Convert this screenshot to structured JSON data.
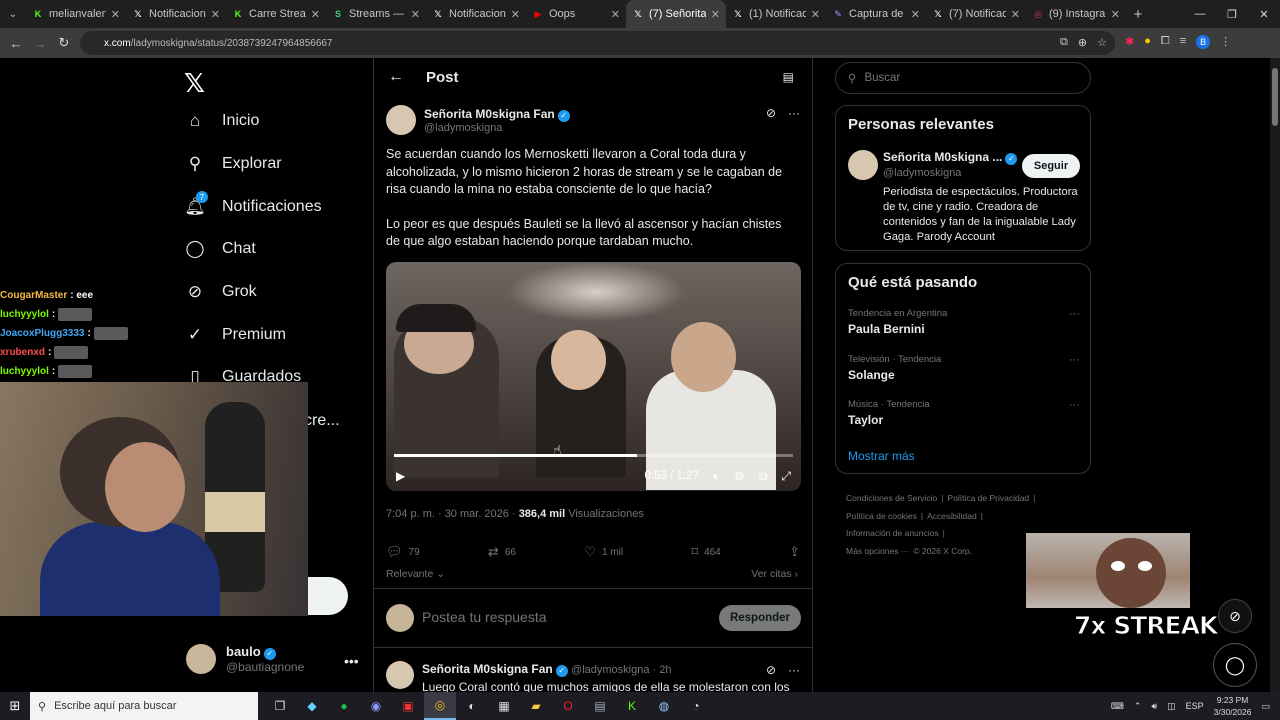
{
  "browser": {
    "tabs": [
      {
        "title": "melianvalen - ",
        "favicon": "kick-icon",
        "color": "#53fc18"
      },
      {
        "title": "Notificaciones",
        "favicon": "x-icon",
        "color": "#ffffff"
      },
      {
        "title": "Carre Stream - ",
        "favicon": "kick-icon",
        "color": "#53fc18"
      },
      {
        "title": "Streams — MC",
        "favicon": "streams-icon",
        "color": "#3fc97a"
      },
      {
        "title": "Notificaciones",
        "favicon": "x-icon",
        "color": "#ffffff"
      },
      {
        "title": "Oops",
        "favicon": "youtube-icon",
        "color": "#ff0000"
      },
      {
        "title": "(7) Señorita M(",
        "favicon": "x-icon",
        "color": "#ffffff"
      },
      {
        "title": "(1) Notificacion",
        "favicon": "x-icon",
        "color": "#ffffff"
      },
      {
        "title": "Captura de pa",
        "favicon": "snip-icon",
        "color": "#b48cff"
      },
      {
        "title": "(7) Notificacio",
        "favicon": "x-icon",
        "color": "#ffffff"
      },
      {
        "title": "(9) Instagram",
        "favicon": "instagram-icon",
        "color": "#e1306c"
      }
    ],
    "active_tab": 6,
    "url_host": "x.com",
    "url_path": "/ladymoskigna/status/2038739247964856667"
  },
  "nav": {
    "items": [
      {
        "label": "Inicio",
        "icon": "home-icon",
        "glyph": "⌂"
      },
      {
        "label": "Explorar",
        "icon": "search-icon",
        "glyph": "⚲"
      },
      {
        "label": "Notificaciones",
        "icon": "bell-icon",
        "glyph": "🔔︎",
        "badge": "7"
      },
      {
        "label": "Chat",
        "icon": "chat-icon",
        "glyph": "◯"
      },
      {
        "label": "Grok",
        "icon": "grok-icon",
        "glyph": "⊘"
      },
      {
        "label": "Premium",
        "icon": "premium-icon",
        "glyph": "✓"
      },
      {
        "label": "Guardados",
        "icon": "bookmark-icon",
        "glyph": "▯"
      }
    ],
    "partial_label": "cre...",
    "account": {
      "name": "baulo",
      "handle": "@bautiagnone"
    }
  },
  "post": {
    "header_title": "Post",
    "author_name": "Señorita M0skigna Fan",
    "author_handle": "@ladymoskigna",
    "paragraph1": "Se acuerdan cuando los Mernosketti llevaron a Coral toda dura y alcoholizada, y lo mismo hicieron 2 horas de stream y se le cagaban de risa cuando la mina no estaba consciente de lo que hacía?",
    "paragraph2": "Lo peor es que después Bauleti se la llevó al ascensor y hacían chistes de que algo estaban haciendo porque tardaban mucho.",
    "video": {
      "time": "0:53 / 1:27",
      "progress": 0.609
    },
    "time": "7:04 p. m. · 30 mar. 2026 · ",
    "views": "386,4 mil",
    "views_label": " Visualizaciones",
    "replies": "79",
    "reposts": "66",
    "likes": "1 mil",
    "bookmarks": "464",
    "sort_label": "Relevante",
    "quotes_label": "Ver citas",
    "reply_placeholder": "Postea tu respuesta",
    "reply_button": "Responder"
  },
  "reply_tweet": {
    "author_name": "Señorita M0skigna Fan",
    "meta": "@ladymoskigna · 2h",
    "text": "Luego Coral contó que muchos amigos de ella se molestaron con los"
  },
  "sidebar": {
    "search_placeholder": "Buscar",
    "who_title": "Personas relevantes",
    "who_name": "Señorita M0skigna ...",
    "who_handle": "@ladymoskigna",
    "who_bio": "Periodista de espectáculos. Productora de tv, cine y radio. Creadora de contenidos y fan de la inigualable Lady Gaga. Parody Account",
    "follow_label": "Seguir",
    "trends_title": "Qué está pasando",
    "trends": [
      {
        "context": "Tendencia en Argentina",
        "title": "Paula Bernini"
      },
      {
        "context": "Televisión · Tendencia",
        "title": "Solange"
      },
      {
        "context": "Música · Tendencia",
        "title": "Taylor"
      }
    ],
    "show_more": "Mostrar más",
    "footer": [
      "Condiciones de Servicio",
      "|",
      "Política de Privacidad",
      "|",
      "Política de cookies",
      "|",
      "Accesibilidad",
      "|",
      "Información de anuncios",
      "|",
      "Más opciones ···",
      "© 2026 X Corp."
    ]
  },
  "overlay": {
    "chat": [
      {
        "user": "CougarMaster",
        "msg": ": eee",
        "color": "#f4b942"
      },
      {
        "user": "luchyyylol",
        "msg": ":",
        "color": "#7cfc00"
      },
      {
        "user": "JoacoxPlugg3333",
        "msg": ":",
        "color": "#3fa9f5"
      },
      {
        "user": "xrubenxd",
        "msg": ":",
        "color": "#ff4d4d"
      },
      {
        "user": "luchyyylol",
        "msg": ":",
        "color": "#7cfc00"
      }
    ],
    "streak": "7x STREAK"
  },
  "taskbar": {
    "search_placeholder": "Escribe aquí para buscar",
    "lang": "ESP",
    "time": "9:23 PM",
    "date": "3/30/2026"
  }
}
